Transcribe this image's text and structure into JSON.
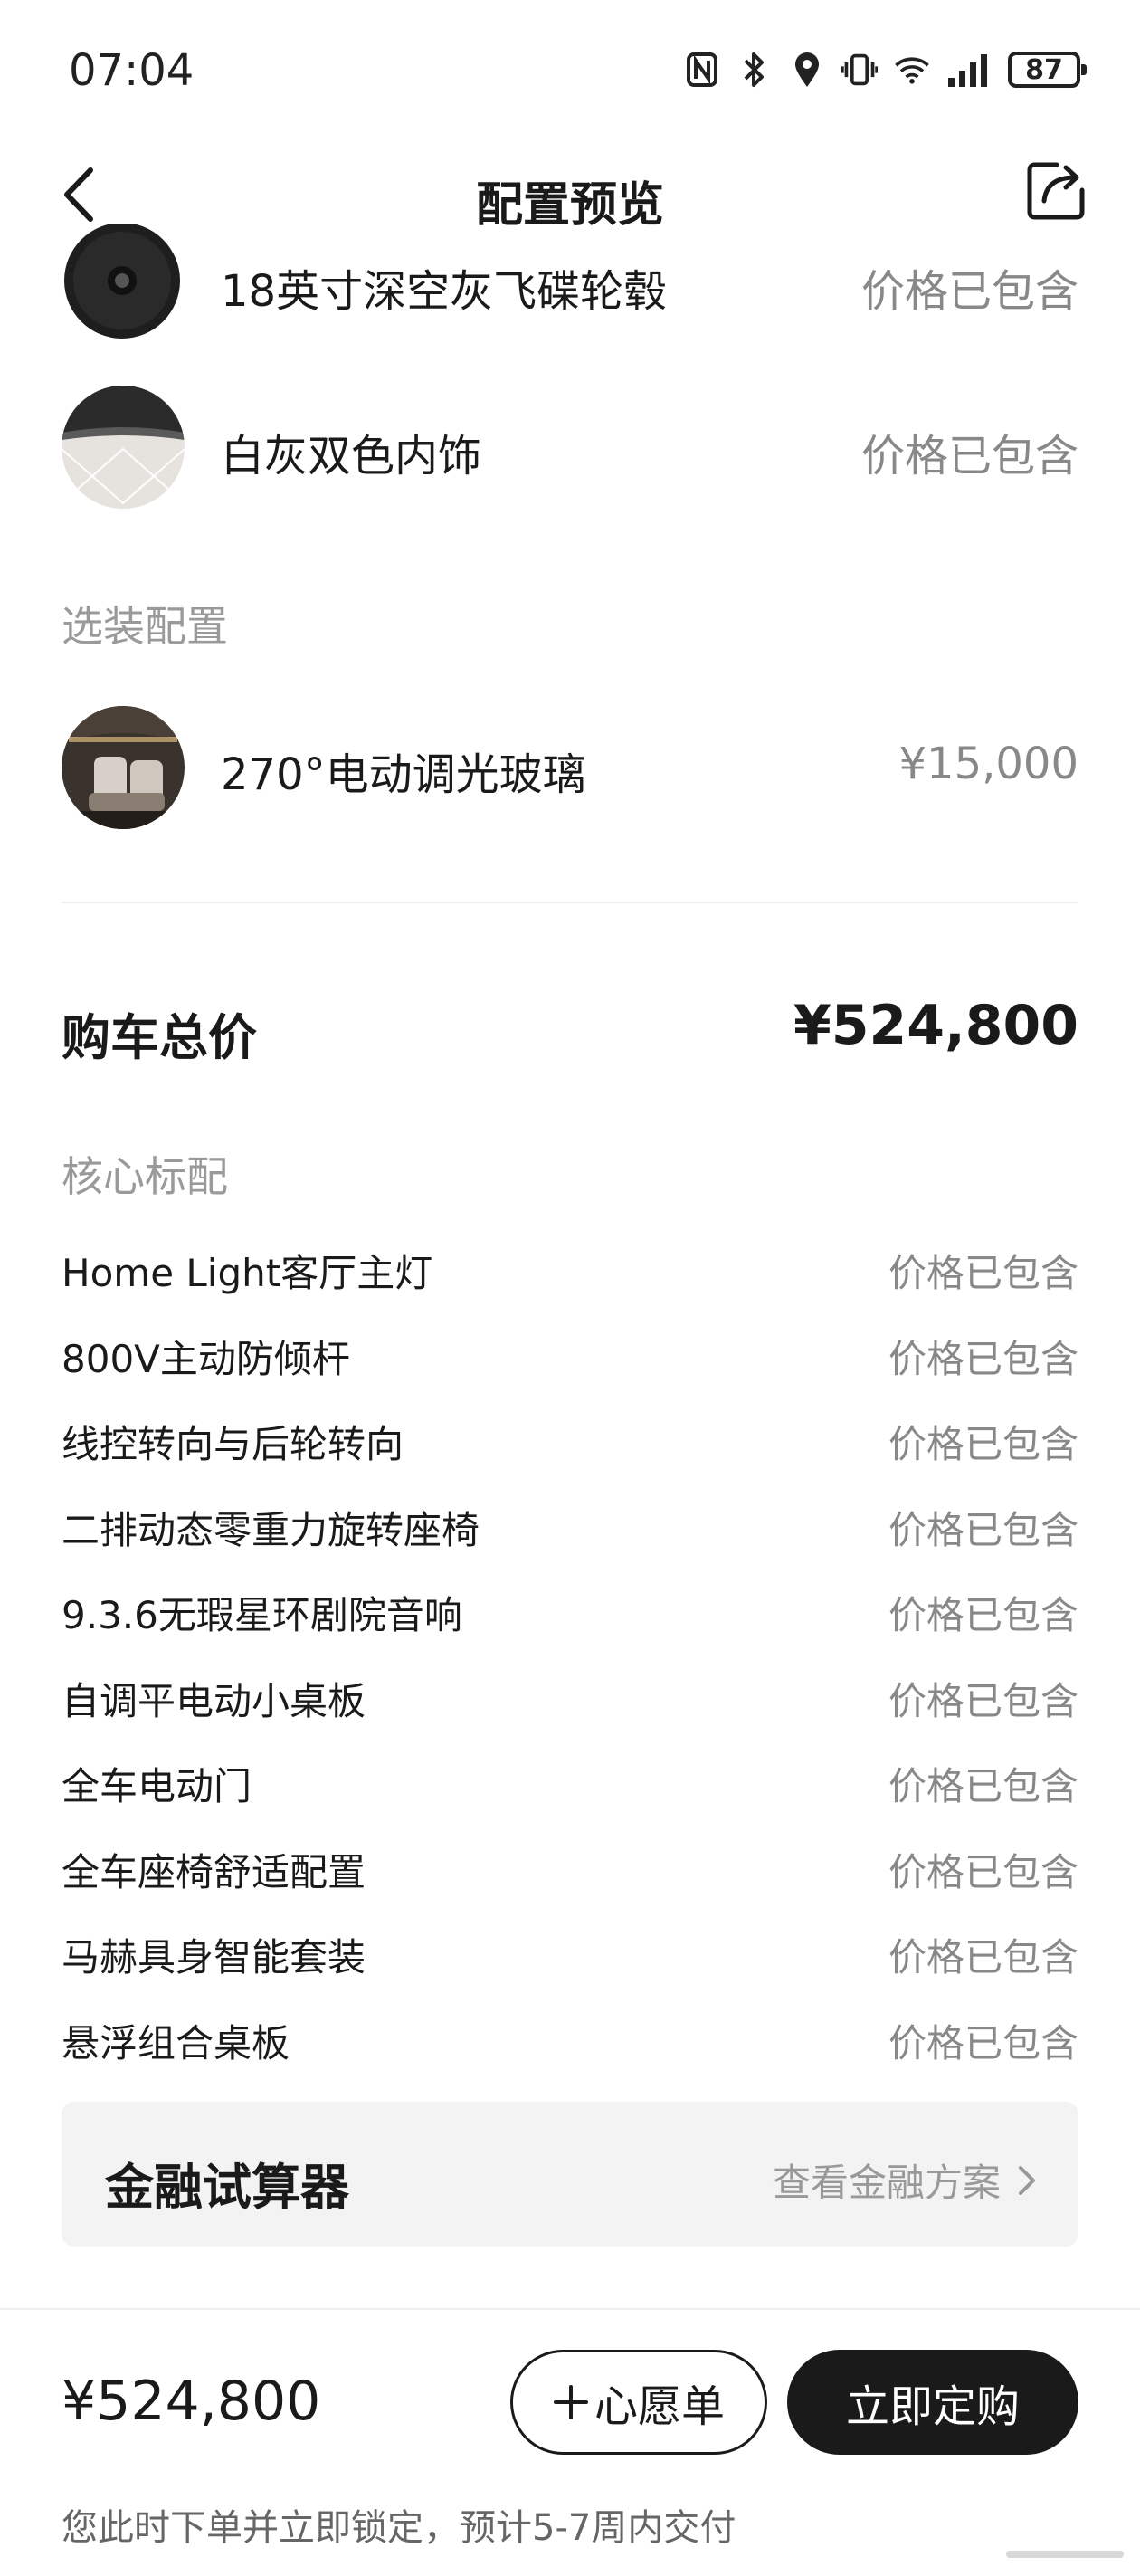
{
  "status_bar": {
    "time": "07:04",
    "battery": "87",
    "icons": [
      "nfc-icon",
      "bluetooth-icon",
      "location-icon",
      "vibrate-icon",
      "wifi-icon",
      "signal-icon",
      "battery-icon"
    ]
  },
  "header": {
    "title": "配置预览",
    "back_icon": "chevron-left-icon",
    "share_icon": "share-icon"
  },
  "selected_items": [
    {
      "name": "18英寸深空灰飞碟轮毂",
      "value": "价格已包含"
    },
    {
      "name": "白灰双色内饰",
      "value": "价格已包含"
    }
  ],
  "optional": {
    "section_label": "选装配置",
    "items": [
      {
        "name": "270°电动调光玻璃",
        "value": "¥15,000"
      }
    ]
  },
  "total": {
    "label": "购车总价",
    "value": "¥524,800"
  },
  "core": {
    "section_label": "核心标配",
    "items": [
      {
        "name": "Home Light客厅主灯",
        "value": "价格已包含"
      },
      {
        "name": "800V主动防倾杆",
        "value": "价格已包含"
      },
      {
        "name": "线控转向与后轮转向",
        "value": "价格已包含"
      },
      {
        "name": "二排动态零重力旋转座椅",
        "value": "价格已包含"
      },
      {
        "name": "9.3.6无瑕星环剧院音响",
        "value": "价格已包含"
      },
      {
        "name": "自调平电动小桌板",
        "value": "价格已包含"
      },
      {
        "name": "全车电动门",
        "value": "价格已包含"
      },
      {
        "name": "全车座椅舒适配置",
        "value": "价格已包含"
      },
      {
        "name": "马赫具身智能套装",
        "value": "价格已包含"
      },
      {
        "name": "悬浮组合桌板",
        "value": "价格已包含"
      }
    ]
  },
  "finance": {
    "title": "金融试算器",
    "link": "查看金融方案"
  },
  "bottom": {
    "price": "¥524,800",
    "wishlist_label": "心愿单",
    "order_label": "立即定购",
    "note": "您此时下单并立即锁定，预计5-7周内交付"
  },
  "colors": {
    "primary": "#1a1a1a",
    "muted": "#888888",
    "card_bg": "#f3f3f3",
    "button_text": "#ffffff"
  }
}
